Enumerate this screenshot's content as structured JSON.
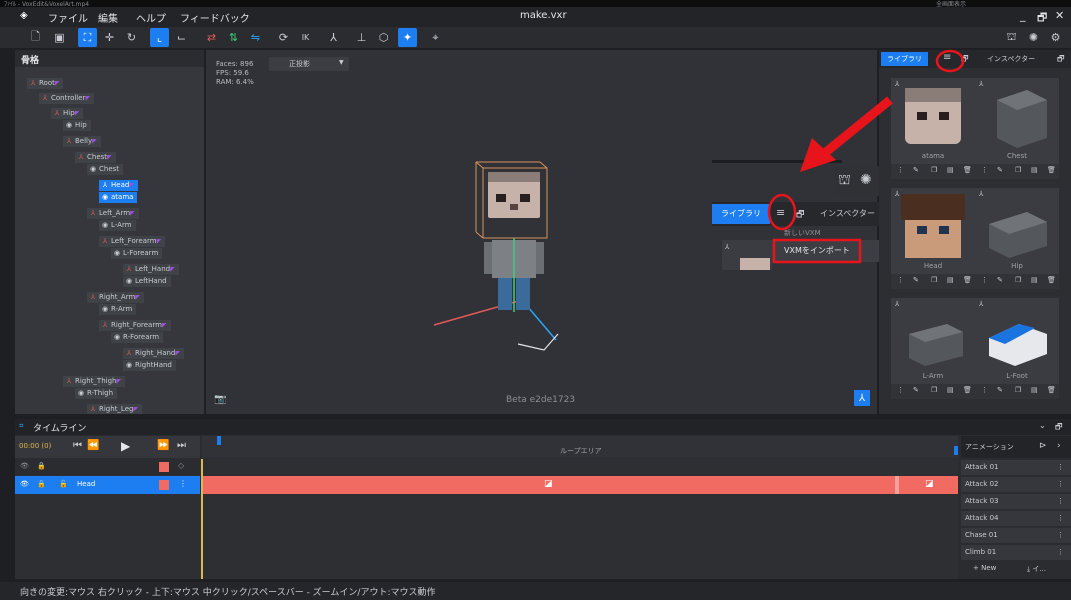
{
  "os_bar": {
    "left_text": "ﾌｧｲﾙ - VoxEdit&VoxelArt.mp4",
    "right_text": "全画面表示"
  },
  "menu": {
    "items": [
      "ファイル",
      "編集",
      "ヘルプ",
      "フィードバック"
    ],
    "title": "make.vxr",
    "minimize": "_",
    "restore": "🗗",
    "close": "✕"
  },
  "skeleton": {
    "title": "骨格",
    "nodes": [
      {
        "label": "Root",
        "kind": "bone"
      },
      {
        "label": "Controller",
        "kind": "bone"
      },
      {
        "label": "Hip",
        "kind": "bone"
      },
      {
        "label": "Hip",
        "kind": "mesh"
      },
      {
        "label": "Belly",
        "kind": "bone"
      },
      {
        "label": "Chest",
        "kind": "bone"
      },
      {
        "label": "Chest",
        "kind": "mesh"
      },
      {
        "label": "Head",
        "kind": "bone"
      },
      {
        "label": "atama",
        "kind": "mesh"
      },
      {
        "label": "Left_Arm",
        "kind": "bone"
      },
      {
        "label": "L-Arm",
        "kind": "mesh"
      },
      {
        "label": "Left_Forearm",
        "kind": "bone"
      },
      {
        "label": "L-Forearm",
        "kind": "mesh"
      },
      {
        "label": "Left_Hand",
        "kind": "bone"
      },
      {
        "label": "LeftHand",
        "kind": "mesh"
      },
      {
        "label": "Right_Arm",
        "kind": "bone"
      },
      {
        "label": "R-Arm",
        "kind": "mesh"
      },
      {
        "label": "Right_Forearm",
        "kind": "bone"
      },
      {
        "label": "R-Forearm",
        "kind": "mesh"
      },
      {
        "label": "Right_Hand",
        "kind": "bone"
      },
      {
        "label": "RightHand",
        "kind": "mesh"
      },
      {
        "label": "Right_Thigh",
        "kind": "bone"
      },
      {
        "label": "R-Thigh",
        "kind": "mesh"
      },
      {
        "label": "Right_Leg",
        "kind": "bone"
      }
    ]
  },
  "viewport": {
    "stats": [
      "Faces: 896",
      "FPS: 59.6",
      "RAM: 6.4%"
    ],
    "projection": "正投影",
    "version": "Beta e2de1723"
  },
  "library": {
    "tab_library": "ライブラリ",
    "tab_inspector": "インスペクター",
    "cards": [
      "atama",
      "Chest",
      "Head",
      "Hip",
      "L-Arm",
      "L-Foot"
    ]
  },
  "popup": {
    "tab_library": "ライブラリ",
    "tab_inspector": "インスペクター",
    "menu_new": "新しいVXM",
    "menu_import": "VXMをインポート"
  },
  "timeline": {
    "title": "タイムライン",
    "time": "00:00 (0)",
    "loop_area": "ループエリア",
    "track_name": "Head",
    "anim_header": "アニメーション",
    "animations": [
      "Attack 01",
      "Attack 02",
      "Attack 03",
      "Attack 04",
      "Chase 01",
      "Climb 01"
    ],
    "new_label": "+ New",
    "import_label": "⤓ イ..."
  },
  "status_text": "向きの変更:マウス 右クリック - 上下:マウス 中クリック/スペースバー - ズームイン/アウト:マウス動作",
  "colors": {
    "accent": "#1c7ef0",
    "track": "#f26b63",
    "highlight": "#e8141c"
  }
}
